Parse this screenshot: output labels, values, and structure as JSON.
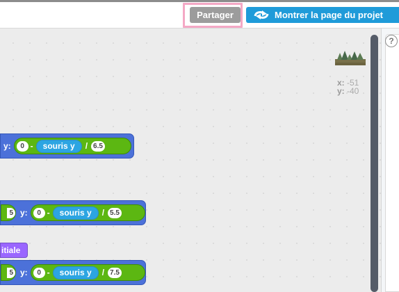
{
  "header": {
    "share_label": "Partager",
    "project_page_label": "Montrer la page du projet"
  },
  "stage": {
    "x_label": "x:",
    "x_value": "-51",
    "y_label": "y:",
    "y_value": "-40"
  },
  "blocks": [
    {
      "y_label": "y:",
      "left_num": "0",
      "minus": "-",
      "sensing_label": "souris y",
      "slash": "/",
      "right_num": "6.5"
    },
    {
      "partial_num": "5",
      "y_label": "y:",
      "left_num": "0",
      "minus": "-",
      "sensing_label": "souris y",
      "slash": "/",
      "right_num": "5.5"
    },
    {
      "partial_num": "5",
      "y_label": "y:",
      "left_num": "0",
      "minus": "-",
      "sensing_label": "souris y",
      "slash": "/",
      "right_num": "7.5"
    }
  ],
  "purple_block": {
    "label": "itiale"
  },
  "help": {
    "label": "?"
  },
  "icons": {
    "project": "sync-arrows-icon",
    "help": "question-mark-icon",
    "sprite": "forest-sprite-thumbnail"
  },
  "colors": {
    "share": "#9c9c9c",
    "project_button": "#1f9bd9",
    "motion_block": "#4c71d9",
    "operator_block": "#5cb712",
    "sensing_block": "#2ca5e2",
    "looks_block": "#9a66ff",
    "highlight": "#f4a8c5"
  }
}
